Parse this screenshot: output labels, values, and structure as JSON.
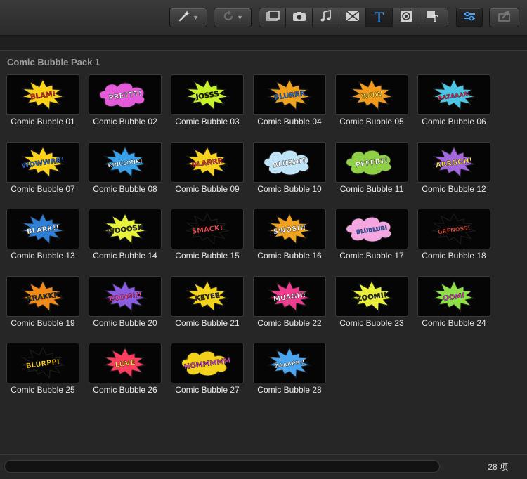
{
  "toolbar": {
    "buttons": [
      {
        "icon": "magic-wand-icon"
      },
      {
        "icon": "redo-icon"
      },
      {
        "icon": "film-icon"
      },
      {
        "icon": "camera-icon"
      },
      {
        "icon": "music-note-icon"
      },
      {
        "icon": "transitions-icon"
      },
      {
        "icon": "title-T-icon"
      },
      {
        "icon": "generator-icon"
      },
      {
        "icon": "themes-icon"
      },
      {
        "icon": "inspector-icon"
      },
      {
        "icon": "share-icon"
      }
    ],
    "title_T_glyph": "T"
  },
  "content": {
    "pack_title": "Comic Bubble Pack 1",
    "items": [
      {
        "label": "Comic Bubble 01",
        "text": "BLAM!",
        "fill": "#ffd21a",
        "text_color": "#e0262a"
      },
      {
        "label": "Comic Bubble 02",
        "text": "PRETTT!",
        "fill": "#e35bd8",
        "text_color": "#ffffff"
      },
      {
        "label": "Comic Bubble 03",
        "text": "JOSSS",
        "fill": "#c7f22a",
        "text_color": "#1b1b1b"
      },
      {
        "label": "Comic Bubble 04",
        "text": "BLURRR",
        "fill": "#f0a21f",
        "text_color": "#2f6fd6"
      },
      {
        "label": "Comic Bubble 05",
        "text": "WOW",
        "fill": "#f39a1d",
        "text_color": "#ffe34a"
      },
      {
        "label": "Comic Bubble 06",
        "text": "BAZAAAR!",
        "fill": "#4dc6e6",
        "text_color": "#e53c6a"
      },
      {
        "label": "Comic Bubble 07",
        "text": "WOWWRR!",
        "fill": "#ffd21a",
        "text_color": "#2a6bd8"
      },
      {
        "label": "Comic Bubble 08",
        "text": "KINCLONK!",
        "fill": "#3aa0e8",
        "text_color": "#ffffff"
      },
      {
        "label": "Comic Bubble 09",
        "text": "BLARRR",
        "fill": "#f6d21f",
        "text_color": "#e43b4b"
      },
      {
        "label": "Comic Bubble 10",
        "text": "BLURDIT",
        "fill": "#bfe4f7",
        "text_color": "#ffffff"
      },
      {
        "label": "Comic Bubble 11",
        "text": "PFFFRT!",
        "fill": "#8fd046",
        "text_color": "#ffffff"
      },
      {
        "label": "Comic Bubble 12",
        "text": "ARRGGH!",
        "fill": "#a267dd",
        "text_color": "#ffe34a"
      },
      {
        "label": "Comic Bubble 13",
        "text": "BLARK!!",
        "fill": "#2e7fd8",
        "text_color": "#ffffff"
      },
      {
        "label": "Comic Bubble 14",
        "text": "WOOOSH",
        "fill": "#e8f23a",
        "text_color": "#2b2b2b"
      },
      {
        "label": "Comic Bubble 15",
        "text": "SMACK!",
        "fill": "#050505",
        "text_color": "#ff4b4b"
      },
      {
        "label": "Comic Bubble 16",
        "text": "SWOSH!",
        "fill": "#f0a21f",
        "text_color": "#ffffff"
      },
      {
        "label": "Comic Bubble 17",
        "text": "BLUBLUB!",
        "fill": "#f3a6e0",
        "text_color": "#2b63d2"
      },
      {
        "label": "Comic Bubble 18",
        "text": "GRENOSS!",
        "fill": "#050505",
        "text_color": "#e34b2a"
      },
      {
        "label": "Comic Bubble 19",
        "text": "KRAKKK",
        "fill": "#f08a1a",
        "text_color": "#2a2a2a"
      },
      {
        "label": "Comic Bubble 20",
        "text": "ZOOM!!!",
        "fill": "#8a5ce0",
        "text_color": "#ff4a9a"
      },
      {
        "label": "Comic Bubble 21",
        "text": "KEYEE",
        "fill": "#f3d41a",
        "text_color": "#2a2a2a"
      },
      {
        "label": "Comic Bubble 22",
        "text": "MUAGH!",
        "fill": "#ef3c8f",
        "text_color": "#ffffff"
      },
      {
        "label": "Comic Bubble 23",
        "text": "ZOOM!!",
        "fill": "#e9f03a",
        "text_color": "#2a2a2a"
      },
      {
        "label": "Comic Bubble 24",
        "text": "OOM!",
        "fill": "#8ee04a",
        "text_color": "#e34bd0"
      },
      {
        "label": "Comic Bubble 25",
        "text": "BLURPP!",
        "fill": "#050505",
        "text_color": "#ffd21a"
      },
      {
        "label": "Comic Bubble 26",
        "text": "LOVE",
        "fill": "#ff3d5e",
        "text_color": "#ffe34a"
      },
      {
        "label": "Comic Bubble 27",
        "text": "HOMMMMM",
        "fill": "#f2d21a",
        "text_color": "#d742c9"
      },
      {
        "label": "Comic Bubble 28",
        "text": "ZAAAPP!!",
        "fill": "#4aa6f0",
        "text_color": "#ffffff"
      }
    ]
  },
  "footer": {
    "item_count": "28 项"
  },
  "colors": {
    "accent": "#4aa3ff",
    "background": "#262626"
  }
}
